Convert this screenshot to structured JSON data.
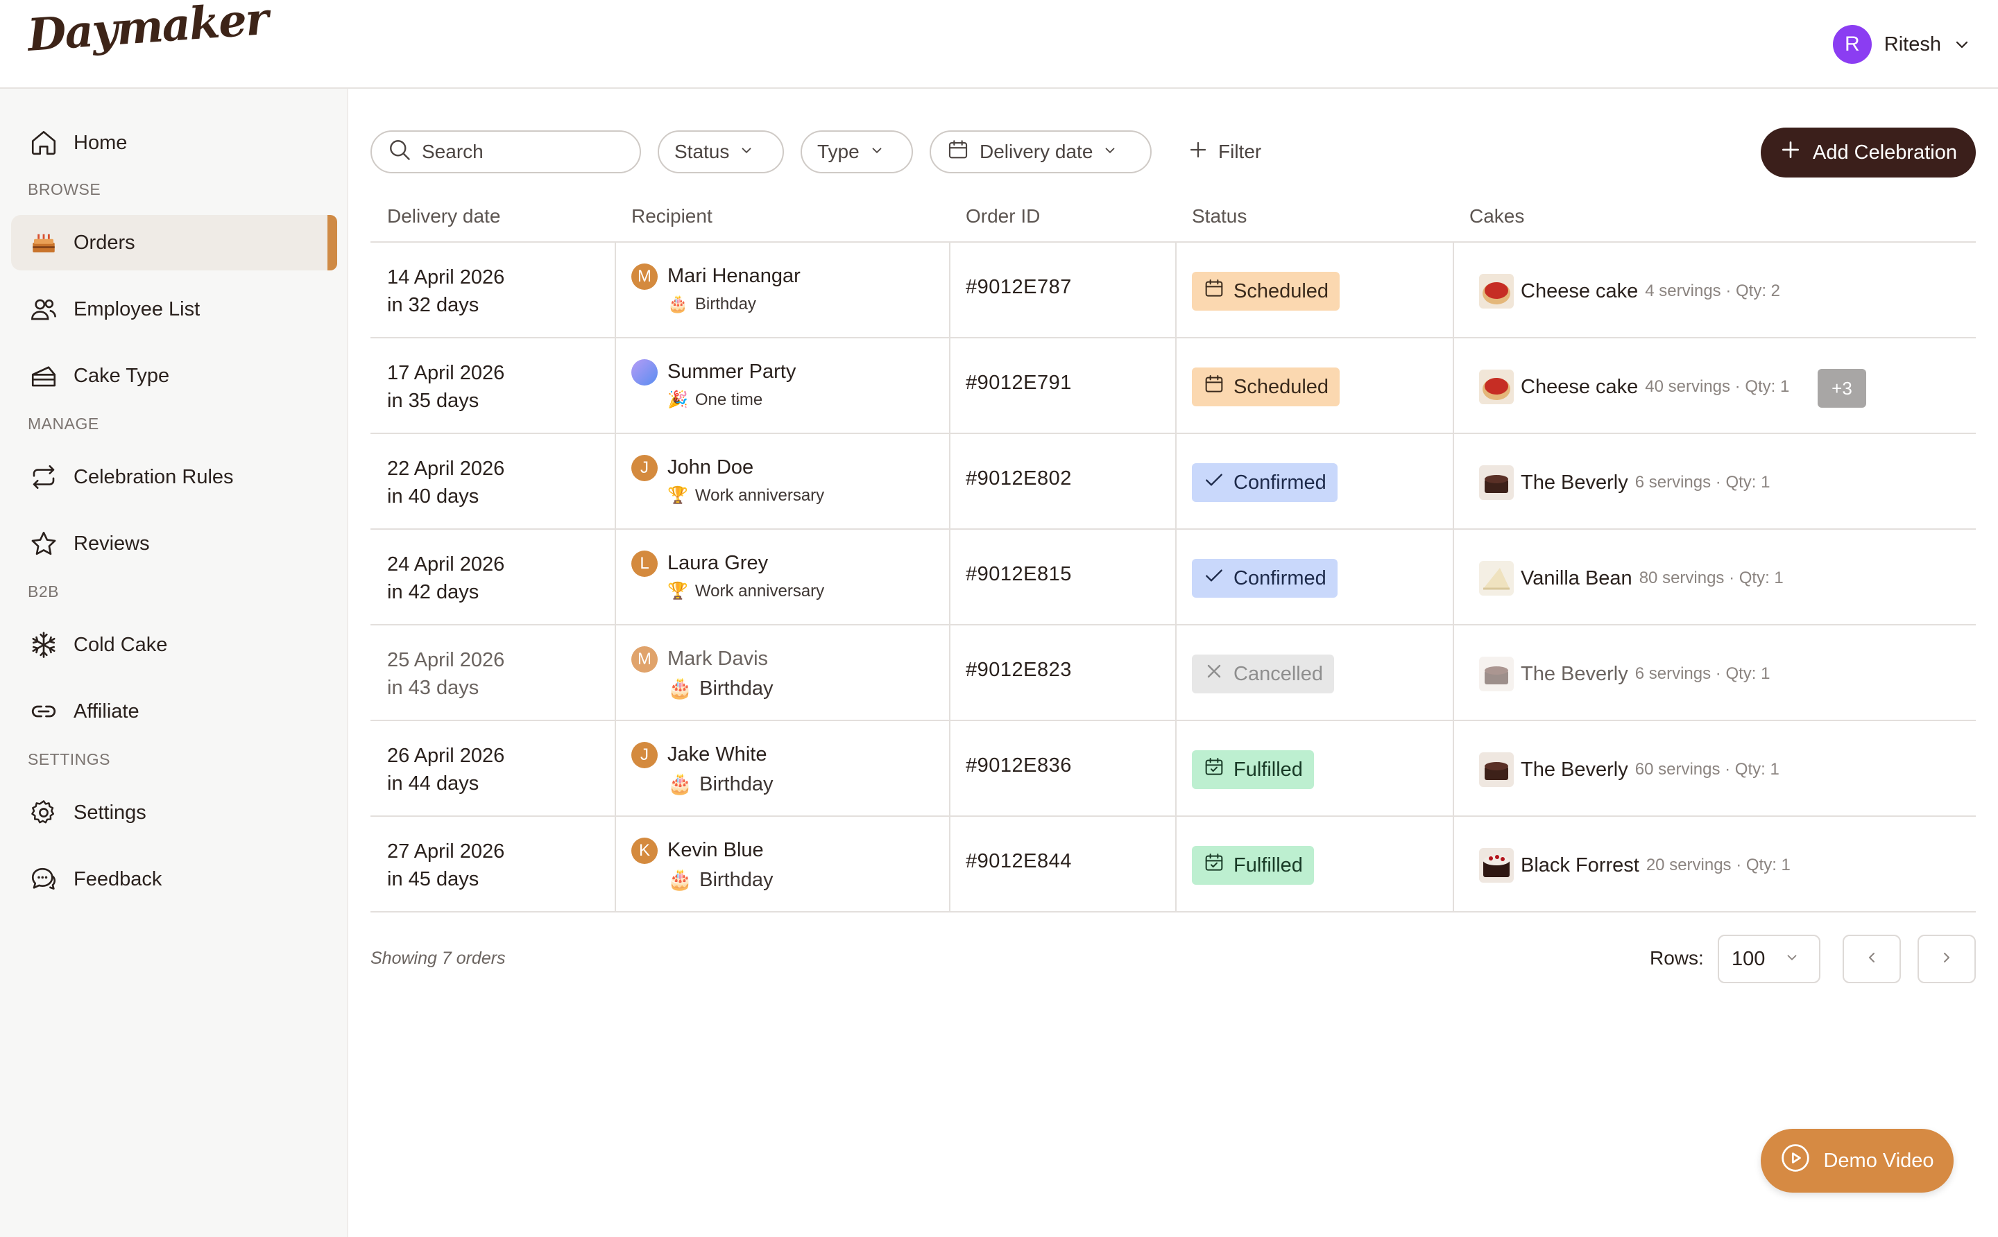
{
  "app": {
    "logo": "Daymaker"
  },
  "user": {
    "initial": "R",
    "name": "Ritesh"
  },
  "sidebar": {
    "home": "Home",
    "browse_label": "BROWSE",
    "orders": "Orders",
    "employee_list": "Employee List",
    "cake_type": "Cake Type",
    "manage_label": "MANAGE",
    "celebration_rules": "Celebration Rules",
    "reviews": "Reviews",
    "b2b_label": "B2B",
    "cold_cake": "Cold Cake",
    "affiliate": "Affiliate",
    "settings_label": "SETTINGS",
    "settings": "Settings",
    "feedback": "Feedback"
  },
  "toolbar": {
    "search_placeholder": "Search",
    "status": "Status",
    "type": "Type",
    "delivery_date": "Delivery date",
    "filter": "Filter",
    "add_celebration": "Add Celebration"
  },
  "table": {
    "headers": [
      "Delivery date",
      "Recipient",
      "Order ID",
      "Status",
      "Cakes"
    ],
    "rows": [
      {
        "date": "14 April 2026",
        "days": "in 32 days",
        "initial": "M",
        "recipient": "Mari Henangar",
        "occasion_icon": "🎂",
        "occasion": "Birthday",
        "order_id": "#9012E787",
        "status": "Scheduled",
        "cake": "Cheese cake",
        "cake_meta": "4 servings · Qty: 2",
        "more": ""
      },
      {
        "date": "17 April 2026",
        "days": "in 35 days",
        "initial": "",
        "recipient": "Summer Party",
        "occasion_icon": "🎉",
        "occasion": "One time",
        "order_id": "#9012E791",
        "status": "Scheduled",
        "cake": "Cheese cake",
        "cake_meta": "40 servings · Qty: 1",
        "more": "+3"
      },
      {
        "date": "22 April 2026",
        "days": "in 40 days",
        "initial": "J",
        "recipient": "John Doe",
        "occasion_icon": "🏆",
        "occasion": "Work anniversary",
        "order_id": "#9012E802",
        "status": "Confirmed",
        "cake": "The Beverly",
        "cake_meta": "6 servings · Qty: 1",
        "more": ""
      },
      {
        "date": "24 April 2026",
        "days": "in 42 days",
        "initial": "L",
        "recipient": "Laura Grey",
        "occasion_icon": "🏆",
        "occasion": "Work anniversary",
        "order_id": "#9012E815",
        "status": "Confirmed",
        "cake": "Vanilla Bean",
        "cake_meta": "80 servings · Qty: 1",
        "more": ""
      },
      {
        "date": "25 April 2026",
        "days": "in 43 days",
        "initial": "M",
        "recipient": "Mark Davis",
        "occasion_icon": "🎂",
        "occasion": "Birthday",
        "order_id": "#9012E823",
        "status": "Cancelled",
        "cake": "The Beverly",
        "cake_meta": "6 servings · Qty: 1",
        "more": ""
      },
      {
        "date": "26 April 2026",
        "days": "in 44 days",
        "initial": "J",
        "recipient": "Jake White",
        "occasion_icon": "🎂",
        "occasion": "Birthday",
        "order_id": "#9012E836",
        "status": "Fulfilled",
        "cake": "The Beverly",
        "cake_meta": "60 servings · Qty: 1",
        "more": ""
      },
      {
        "date": "27 April 2026",
        "days": "in 45 days",
        "initial": "K",
        "recipient": "Kevin Blue",
        "occasion_icon": "🎂",
        "occasion": "Birthday",
        "order_id": "#9012E844",
        "status": "Fulfilled",
        "cake": "Black Forrest",
        "cake_meta": "20 servings · Qty: 1",
        "more": ""
      }
    ]
  },
  "footer": {
    "showing": "Showing 7 orders",
    "rows_label": "Rows:",
    "rows_value": "100"
  },
  "demo_video": "Demo Video",
  "colors": {
    "accent": "#cf8a45",
    "primary_button": "#3b1f1b",
    "scheduled": "#fbd8b0",
    "confirmed": "#c9d8fb",
    "cancelled": "#e7e7e7",
    "fulfilled": "#bdefd0"
  }
}
